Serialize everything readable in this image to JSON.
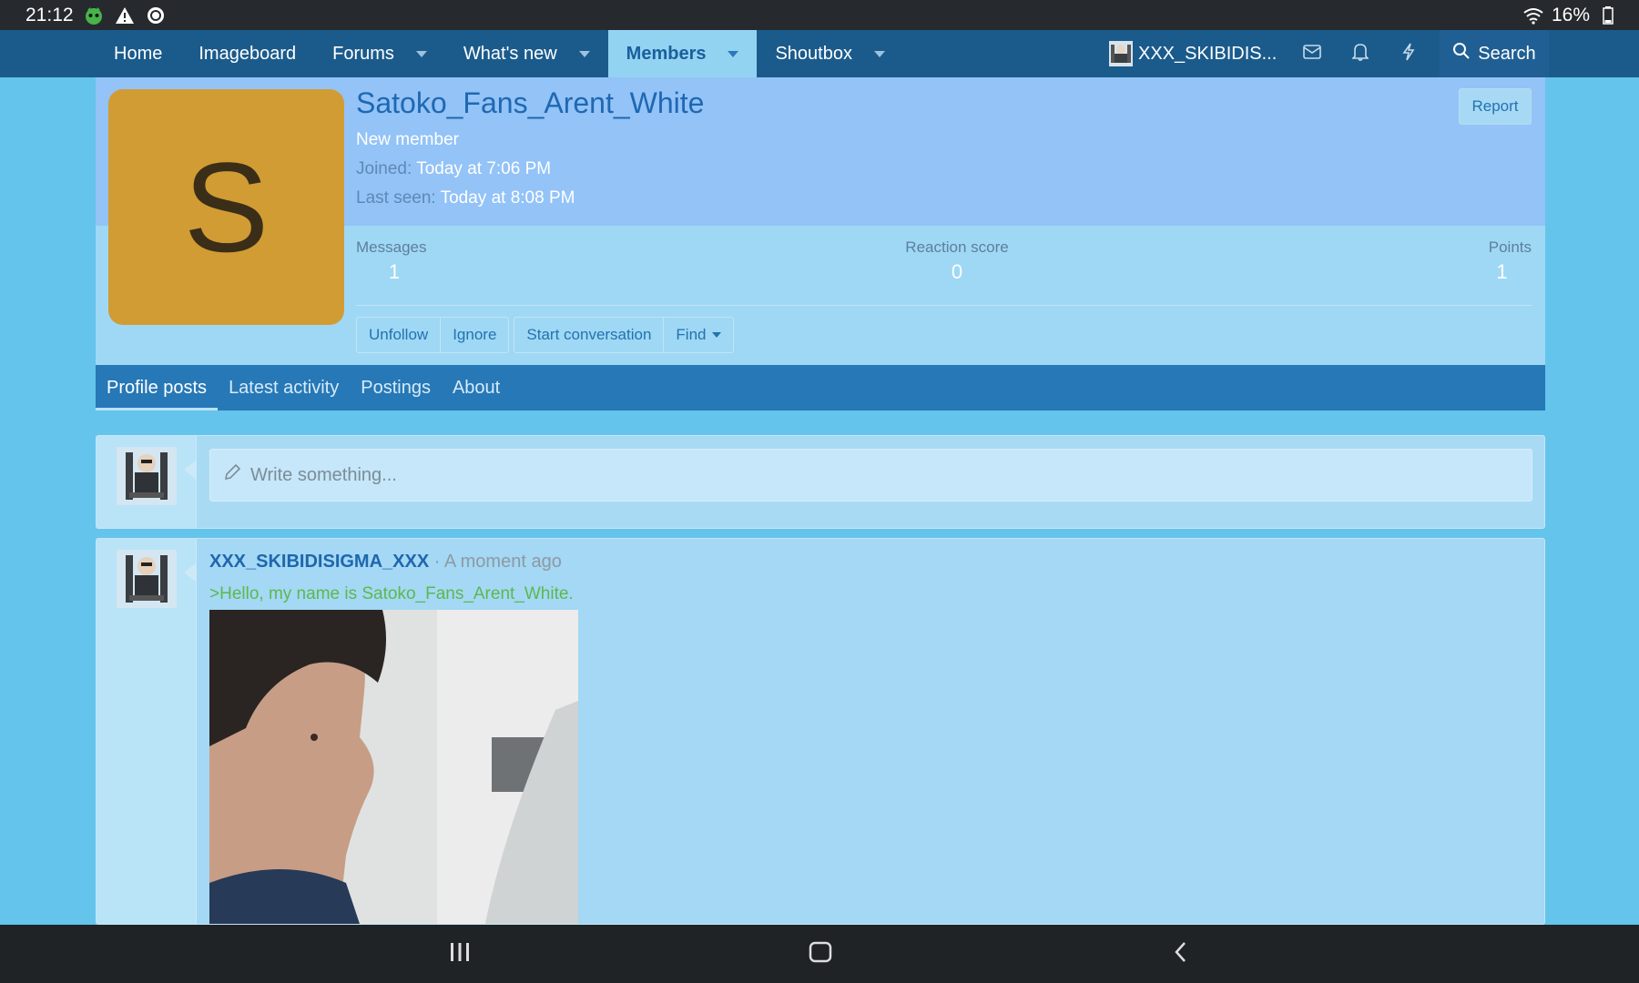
{
  "status_bar": {
    "time": "21:12",
    "battery": "16%"
  },
  "nav": {
    "items": [
      {
        "label": "Home"
      },
      {
        "label": "Imageboard"
      },
      {
        "label": "Forums"
      },
      {
        "label": "What's new"
      },
      {
        "label": "Members"
      },
      {
        "label": "Shoutbox"
      }
    ],
    "user": "XXX_SKIBIDIS...",
    "search_label": "Search"
  },
  "profile": {
    "avatar_letter": "S",
    "username": "Satoko_Fans_Arent_White",
    "user_title": "New member",
    "joined_label": "Joined:",
    "joined_value": "Today at 7:06 PM",
    "last_seen_label": "Last seen:",
    "last_seen_value": "Today at 8:08 PM",
    "report_label": "Report",
    "stats": {
      "messages_label": "Messages",
      "messages_value": "1",
      "reaction_label": "Reaction score",
      "reaction_value": "0",
      "points_label": "Points",
      "points_value": "1"
    },
    "actions": {
      "unfollow": "Unfollow",
      "ignore": "Ignore",
      "start_conversation": "Start conversation",
      "find": "Find"
    },
    "tabs": [
      {
        "label": "Profile posts"
      },
      {
        "label": "Latest activity"
      },
      {
        "label": "Postings"
      },
      {
        "label": "About"
      }
    ]
  },
  "composer": {
    "placeholder": "Write something..."
  },
  "post": {
    "author": "XXX_SKIBIDISIGMA_XXX",
    "time": " · A moment ago",
    "text": ">Hello, my name is Satoko_Fans_Arent_White."
  },
  "colors": {
    "nav_bg": "#1b5b8c",
    "accent": "#2778b6",
    "page_bg": "#64c4ec",
    "avatar_bg": "#d19c33",
    "greentext": "#5cb84f"
  }
}
